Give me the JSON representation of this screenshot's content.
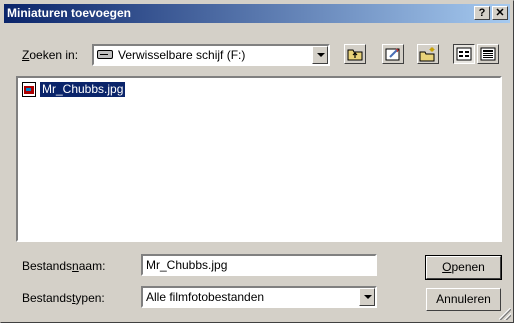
{
  "window": {
    "title": "Miniaturen toevoegen",
    "help_glyph": "?",
    "close_glyph": "✕"
  },
  "look_in": {
    "label_prefix": "Z",
    "label_rest": "oeken in:",
    "value": "Verwisselbare schijf (F:)",
    "icon": "removable-drive-icon"
  },
  "toolbar": {
    "buttons": [
      {
        "name": "up-one-level",
        "icon": "folder-up-icon"
      },
      {
        "name": "create-shortcut",
        "icon": "shortcut-icon"
      },
      {
        "name": "new-folder",
        "icon": "new-folder-icon"
      },
      {
        "name": "list-view",
        "icon": "list-view-icon",
        "pressed": true
      },
      {
        "name": "details-view",
        "icon": "details-view-icon"
      }
    ]
  },
  "files": [
    {
      "name": "Mr_Chubbs.jpg",
      "icon": "jpg-file-icon",
      "selected": true
    }
  ],
  "filename": {
    "label_a": "Bestands",
    "label_u": "n",
    "label_b": "aam:",
    "value": "Mr_Chubbs.jpg"
  },
  "filetype": {
    "label_a": "Bestands",
    "label_u": "t",
    "label_b": "ypen:",
    "value": "Alle filmfotobestanden"
  },
  "buttons": {
    "open_u": "O",
    "open_rest": "penen",
    "cancel": "Annuleren"
  }
}
